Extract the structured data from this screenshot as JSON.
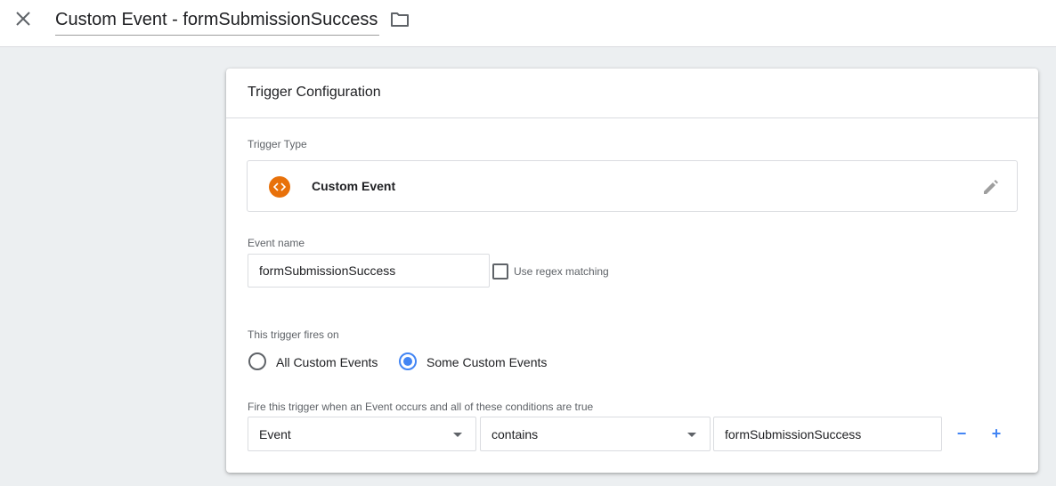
{
  "header": {
    "title": "Custom Event - formSubmissionSuccess",
    "close_icon": "close-icon",
    "folder_icon": "folder-icon"
  },
  "card": {
    "title": "Trigger Configuration",
    "trigger_type": {
      "label": "Trigger Type",
      "name": "Custom Event",
      "icon": "code-icon",
      "icon_color": "#e8710a",
      "edit_icon": "pencil-icon"
    },
    "event_name": {
      "label": "Event name",
      "value": "formSubmissionSuccess",
      "regex_label": "Use regex matching",
      "regex_checked": false
    },
    "fires_on": {
      "label": "This trigger fires on",
      "options": [
        {
          "label": "All Custom Events",
          "selected": false
        },
        {
          "label": "Some Custom Events",
          "selected": true
        }
      ]
    },
    "conditions": {
      "label": "Fire this trigger when an Event occurs and all of these conditions are true",
      "variable": "Event",
      "operator": "contains",
      "value": "formSubmissionSuccess",
      "remove_label": "−",
      "add_label": "+"
    }
  },
  "colors": {
    "accent": "#4285f4",
    "background": "#eceff1",
    "border": "#dadce0"
  }
}
